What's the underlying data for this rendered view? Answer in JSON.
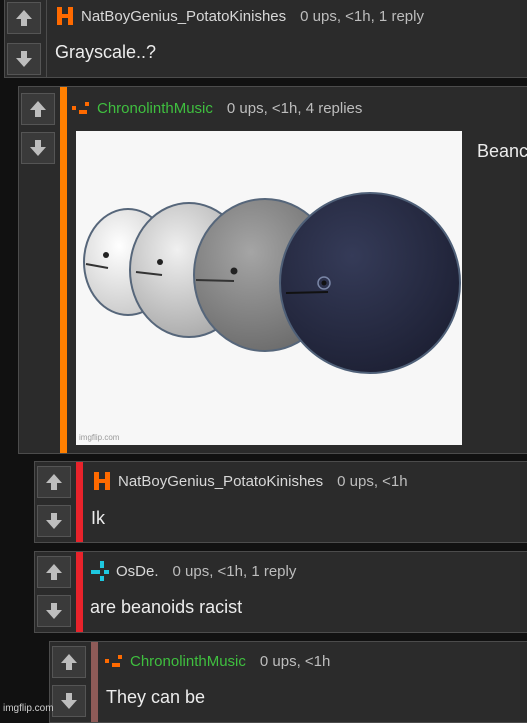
{
  "comments": [
    {
      "username": "NatBoyGenius_PotatoKinishes",
      "meta": "0 ups, <1h, 1 reply",
      "text": "Grayscale..?",
      "avatar_icon": "orange-h-avatar-icon",
      "username_color": "#d8d8d8"
    },
    {
      "username": "ChronolinthMusic",
      "meta": "0 ups, <1h, 4 replies",
      "text": "Beanc",
      "avatar_icon": "orange-pixel-avatar-icon",
      "username_color": "#3fbf3f",
      "image_watermark": "imgflip.com",
      "bar_color": "#ff7f00"
    },
    {
      "username": "NatBoyGenius_PotatoKinishes",
      "meta": "0 ups, <1h",
      "text": "Ik",
      "avatar_icon": "orange-h-avatar-icon",
      "username_color": "#d8d8d8",
      "bar_color": "#e8232b"
    },
    {
      "username": "OsDe.",
      "meta": "0 ups, <1h, 1 reply",
      "text": "are beanoids racist",
      "avatar_icon": "cyan-pixel-avatar-icon",
      "username_color": "#d8d8d8",
      "bar_color": "#e8232b"
    },
    {
      "username": "ChronolinthMusic",
      "meta": "0 ups, <1h",
      "text": "They can be",
      "avatar_icon": "orange-pixel-avatar-icon",
      "username_color": "#3fbf3f",
      "bar_color": "#8e5b58"
    }
  ],
  "page_watermark": "imgflip.com"
}
